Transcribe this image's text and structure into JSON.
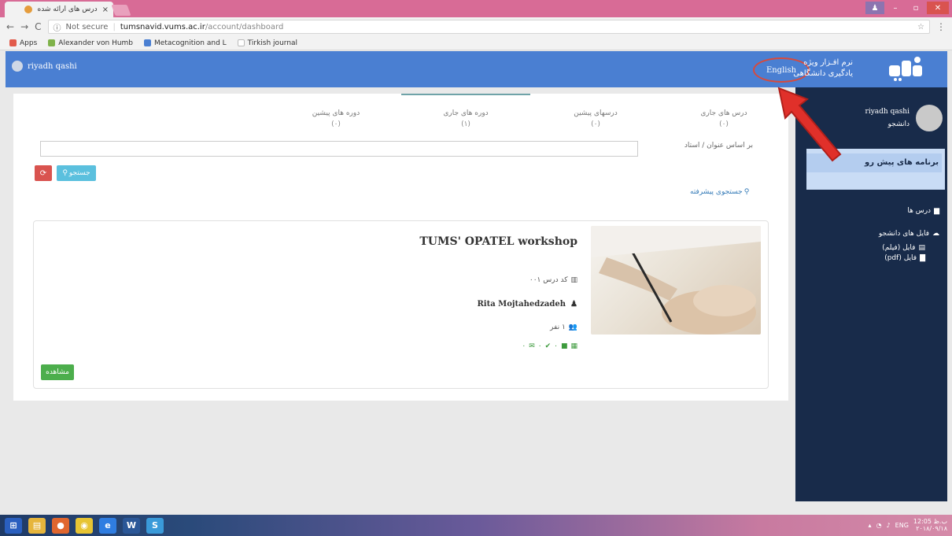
{
  "browser": {
    "tab_title": "درس های ارائه شده",
    "tab_close": "×",
    "url_security": "Not secure",
    "url_host": "tumsnavid.vums.ac.ir",
    "url_path": "/account/dashboard",
    "bookmarks": [
      {
        "label": "Apps",
        "color": "#e25b4b"
      },
      {
        "label": "Alexander von Humb",
        "color": "#7fb24a"
      },
      {
        "label": "Metacognition and L",
        "color": "#4a7fd2"
      },
      {
        "label": "Tirkish journal",
        "color": "#bbbbbb"
      }
    ]
  },
  "header": {
    "user_name": "riyadh qashi",
    "language_button": "English",
    "brand_line1": "نرم افـزار ویژه",
    "brand_line2": "یادگیری دانشگاهی"
  },
  "sidebar": {
    "user_name": "riyadh qashi",
    "user_role": "دانشجو",
    "box_title": "برنامه های پیش رو",
    "menu": {
      "courses": "درس ها",
      "student_files": "فایل های دانشجو",
      "video_files": "فایل (فیلم)",
      "pdf_files": "فایل (pdf)"
    }
  },
  "tabs": [
    {
      "label": "درس های جاری",
      "count": "(۰)"
    },
    {
      "label": "درسهای پیشین",
      "count": "(۰)"
    },
    {
      "label": "دوره های جاری",
      "count": "(۱)"
    },
    {
      "label": "دوره های پیشین",
      "count": "(۰)"
    }
  ],
  "search": {
    "label": "بر اساس عنوان / استاد",
    "placeholder": "",
    "search_button": "جستجو",
    "reset_icon": "⟳",
    "advanced_link": "جستجوی پیشرفته"
  },
  "course": {
    "title": "TUMS' OPATEL workshop",
    "code": "کد درس ۰۰۱",
    "teacher": "Rita Mojtahedzadeh",
    "members": "۱ نفر",
    "stat_a": "۰",
    "stat_b": "۰",
    "stat_c": "۰",
    "view_button": "مشاهده"
  },
  "taskbar": {
    "lang": "ENG",
    "time": "12:05 ب.ظ",
    "date": "۲۰۱۸/۰۹/۱۸"
  },
  "colors": {
    "header_bg": "#4a7fd2",
    "sidebar_bg": "#182b4a",
    "accent_red": "#d74a3c",
    "search_btn": "#5bc0de",
    "view_btn": "#4cae4c"
  }
}
